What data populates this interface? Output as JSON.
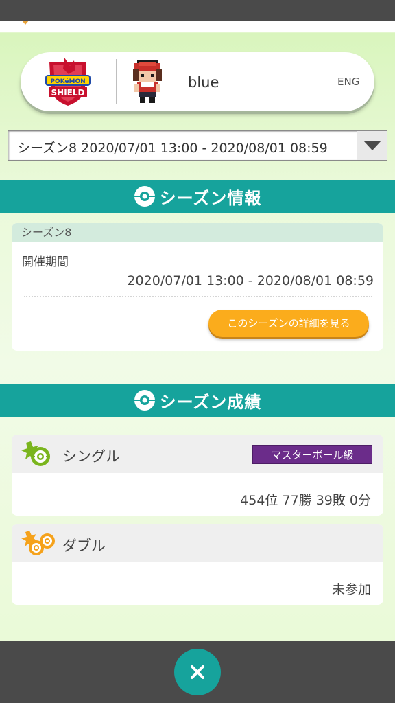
{
  "profile": {
    "game_logo_text": "POKÉMON SHIELD",
    "player_name": "blue",
    "language": "ENG"
  },
  "season_select": {
    "selected": "シーズン8 2020/07/01 13:00 - 2020/08/01 08:59"
  },
  "season_info": {
    "title": "シーズン情報",
    "season_label": "シーズン8",
    "period_label": "開催期間",
    "period_value": "2020/07/01 13:00 - 2020/08/01 08:59",
    "detail_button": "このシーズンの詳細を見る"
  },
  "season_results": {
    "title": "シーズン成績",
    "single": {
      "mode": "シングル",
      "rank": "マスターボール級",
      "record": "454位 77勝 39敗 0分"
    },
    "double": {
      "mode": "ダブル",
      "record": "未参加"
    }
  },
  "colors": {
    "teal": "#16a39c",
    "orange_button": "#fbac1c",
    "master_ball_purple": "#6b2c8a",
    "background_green": "#eaf9d9"
  },
  "icons": {
    "section": "poke-ball-icon",
    "single": "single-battle-icon",
    "double": "double-battle-icon",
    "close": "close-icon"
  }
}
